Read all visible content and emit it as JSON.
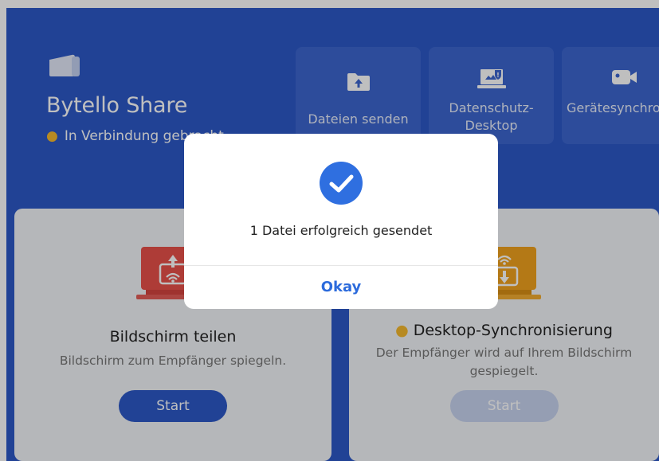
{
  "app": {
    "title": "Bytello Share",
    "status": "In Verbindung gebracht"
  },
  "tiles": [
    {
      "label": "Dateien senden",
      "icon": "upload-folder-icon"
    },
    {
      "label": "Datenschutz-Desktop",
      "icon": "privacy-desktop-icon"
    },
    {
      "label": "Gerätesynchronisierung",
      "icon": "camera-icon"
    }
  ],
  "cards": {
    "left": {
      "title": "Bildschirm teilen",
      "description": "Bildschirm zum Empfänger spiegeln.",
      "button": "Start"
    },
    "right": {
      "title": "Desktop-Synchronisierung",
      "description": "Der Empfänger wird auf Ihrem Bildschirm gespiegelt.",
      "button": "Start"
    }
  },
  "dialog": {
    "message": "1 Datei erfolgreich gesendet",
    "ok_label": "Okay"
  },
  "colors": {
    "primary": "#2c58c7",
    "accent": "#f5b82e",
    "dialog_button": "#2c6bdc"
  }
}
